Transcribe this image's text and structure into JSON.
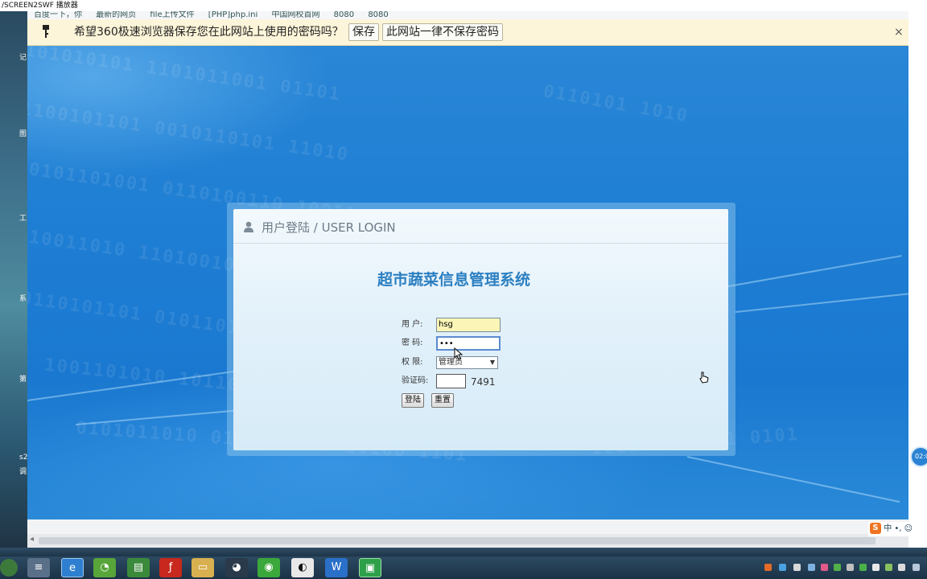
{
  "player": {
    "title": "/SCREEN2SWF 播放器"
  },
  "left_strip_labels": [
    "记",
    "图",
    "工",
    "系",
    "第",
    "s2",
    "调"
  ],
  "bookmarks": [
    "百度一下，你",
    "最新的网页",
    "file上传文件",
    "[PHP]php.ini",
    "中国网校首网",
    "8080",
    "8080"
  ],
  "password_bar": {
    "message": "希望360极速浏览器保存您在此网站上使用的密码吗？",
    "save_label": "保存",
    "never_label": "此网站一律不保存密码",
    "close_label": "×"
  },
  "login": {
    "header": "用户登陆 / USER LOGIN",
    "system_title": "超市蔬菜信息管理系统",
    "user_label": "用 户:",
    "user_value": "hsg",
    "password_label": "密 码:",
    "password_value": "•••",
    "role_label": "权 限:",
    "role_value": "管理员",
    "captcha_label": "验证码:",
    "captcha_value": "",
    "captcha_code": "7491",
    "login_button": "登陆",
    "reset_button": "重置"
  },
  "clock_badge": "02:0",
  "ime": {
    "s": "S",
    "mode": "中"
  },
  "colors": {
    "page_blue": "#1f7fd4",
    "title_blue": "#2b7fc1",
    "bar_yellow": "#fdf5d9"
  }
}
